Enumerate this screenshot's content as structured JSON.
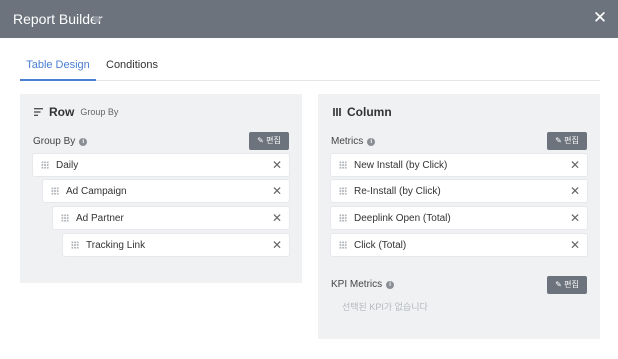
{
  "window": {
    "title": "Report Builder",
    "close_glyph": "✕"
  },
  "tabs": [
    {
      "label": "Table Design",
      "active": true
    },
    {
      "label": "Conditions",
      "active": false
    }
  ],
  "row_panel": {
    "title": "Row",
    "subtitle": "Group By",
    "icon": "sort-lines-icon",
    "section_label": "Group By",
    "edit_label": "편집",
    "items": [
      {
        "label": "Daily"
      },
      {
        "label": "Ad Campaign"
      },
      {
        "label": "Ad Partner"
      },
      {
        "label": "Tracking Link"
      }
    ]
  },
  "column_panel": {
    "title": "Column",
    "icon": "columns-icon",
    "metrics_label": "Metrics",
    "metrics_edit_label": "편집",
    "metrics": [
      {
        "label": "New Install (by Click)"
      },
      {
        "label": "Re-Install (by Click)"
      },
      {
        "label": "Deeplink Open (Total)"
      },
      {
        "label": "Click (Total)"
      }
    ],
    "kpi_label": "KPI Metrics",
    "kpi_edit_label": "편집",
    "kpi_empty": "선택된 KPI가 없습니다"
  },
  "colors": {
    "titlebar": "#6c737d",
    "accent": "#4a7fd3",
    "panel_bg": "#f0f1f3"
  }
}
